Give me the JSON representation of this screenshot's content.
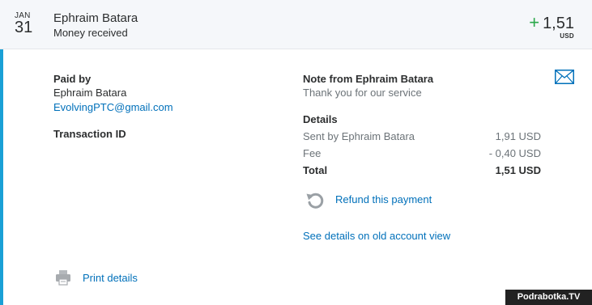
{
  "header": {
    "month": "JAN",
    "day": "31",
    "name": "Ephraim Batara",
    "type": "Money received",
    "amount_sign": "+",
    "amount": "1,51",
    "currency": "USD"
  },
  "paid_by": {
    "heading": "Paid by",
    "name": "Ephraim Batara",
    "email": "EvolvingPTC@gmail.com"
  },
  "transaction": {
    "heading": "Transaction ID"
  },
  "note": {
    "heading": "Note from Ephraim Batara",
    "text": "Thank you for our service"
  },
  "details": {
    "heading": "Details",
    "rows": [
      {
        "label": "Sent by Ephraim Batara",
        "value": "1,91 USD"
      },
      {
        "label": "Fee",
        "value": "- 0,40 USD"
      },
      {
        "label": "Total",
        "value": "1,51 USD"
      }
    ]
  },
  "actions": {
    "refund": "Refund this payment",
    "old_view": "See details on old account view",
    "print": "Print details"
  },
  "icons": {
    "mail": "mail-icon",
    "refund": "refund-icon",
    "print": "printer-icon"
  },
  "watermark": "Podrabotka.TV",
  "colors": {
    "accent": "#1aa0d6",
    "link": "#0070ba",
    "positive": "#2ba84a"
  }
}
